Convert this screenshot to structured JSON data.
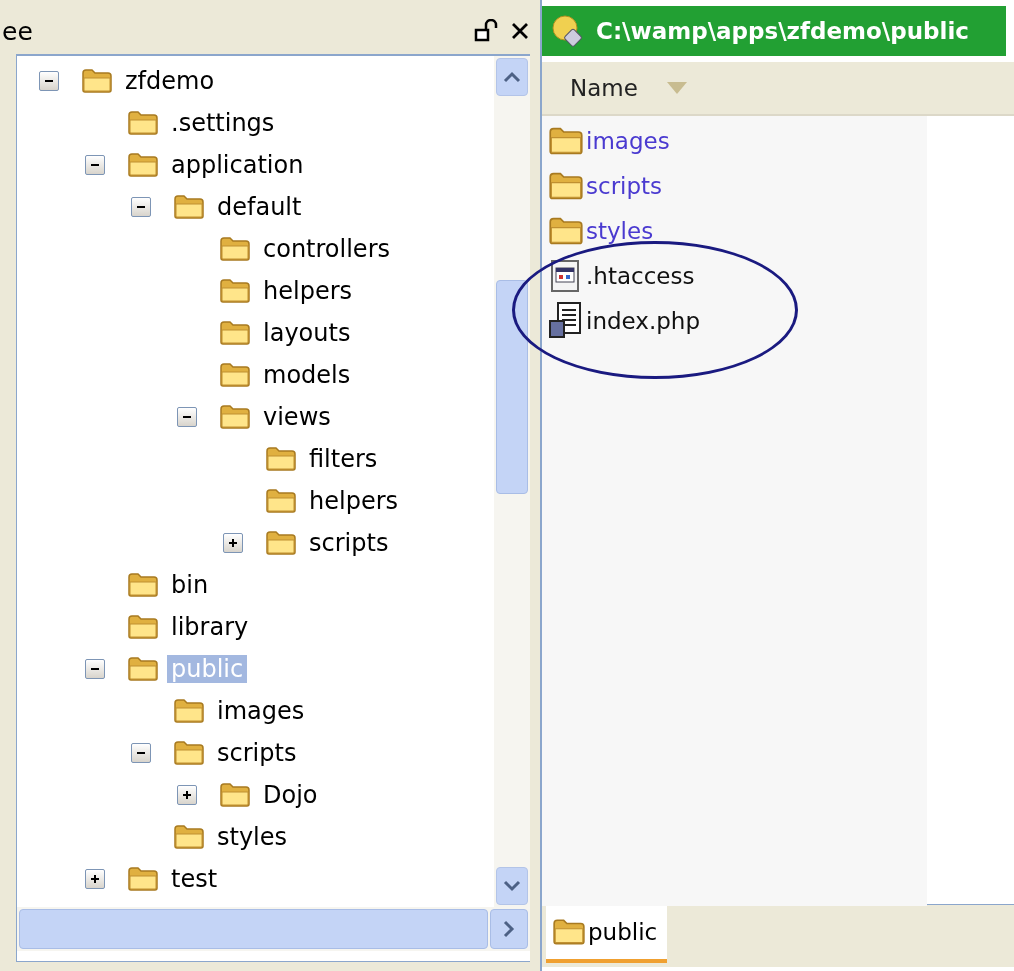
{
  "panel": {
    "title": "ee"
  },
  "tree": [
    {
      "label": "zfdemo",
      "expanded": true,
      "selected": false,
      "children": [
        {
          "label": ".settings",
          "selected": false
        },
        {
          "label": "application",
          "expanded": true,
          "selected": false,
          "children": [
            {
              "label": "default",
              "expanded": true,
              "selected": false,
              "children": [
                {
                  "label": "controllers",
                  "selected": false
                },
                {
                  "label": "helpers",
                  "selected": false
                },
                {
                  "label": "layouts",
                  "selected": false
                },
                {
                  "label": "models",
                  "selected": false
                },
                {
                  "label": "views",
                  "expanded": true,
                  "selected": false,
                  "children": [
                    {
                      "label": "filters",
                      "selected": false
                    },
                    {
                      "label": "helpers",
                      "selected": false
                    },
                    {
                      "label": "scripts",
                      "expanded": false,
                      "selected": false
                    }
                  ]
                }
              ]
            }
          ]
        },
        {
          "label": "bin",
          "selected": false
        },
        {
          "label": "library",
          "selected": false
        },
        {
          "label": "public",
          "expanded": true,
          "selected": true,
          "children": [
            {
              "label": "images",
              "selected": false
            },
            {
              "label": "scripts",
              "expanded": true,
              "selected": false,
              "children": [
                {
                  "label": "Dojo",
                  "expanded": false,
                  "selected": false
                }
              ]
            },
            {
              "label": "styles",
              "selected": false
            }
          ]
        },
        {
          "label": "test",
          "expanded": false,
          "selected": false
        }
      ]
    }
  ],
  "explorer": {
    "title": "C:\\wamp\\apps\\zfdemo\\public",
    "column": {
      "label": "Name",
      "sorted": true
    },
    "files": [
      {
        "name": "images",
        "kind": "folder"
      },
      {
        "name": "scripts",
        "kind": "folder"
      },
      {
        "name": "styles",
        "kind": "folder"
      },
      {
        "name": ".htaccess",
        "kind": "config"
      },
      {
        "name": "index.php",
        "kind": "script"
      }
    ],
    "tabs": [
      {
        "label": "public",
        "selected": true
      }
    ]
  }
}
